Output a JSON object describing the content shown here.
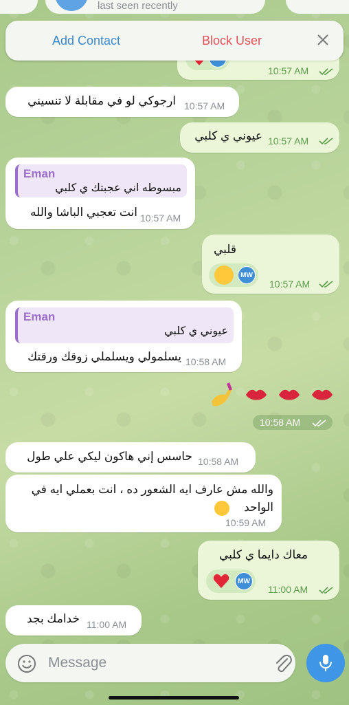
{
  "header": {
    "status": "last seen recently"
  },
  "action_bar": {
    "add_contact": "Add Contact",
    "block_user": "Block User"
  },
  "messages": [
    {
      "time": "10:57 AM",
      "reaction_initials": "MW"
    },
    {
      "text": "ارجوكي لو في مقابلة لا تنسيني",
      "time": "10:57 AM"
    },
    {
      "text": "عيوني ي كلبي",
      "time": "10:57 AM"
    },
    {
      "reply_name": "Eman",
      "reply_text": "مبسوطه اني عجبتك ي كلبي",
      "text": "انت تعجبي الباشا والله",
      "time": "10:57 AM"
    },
    {
      "text": "قلبي",
      "time": "10:57 AM",
      "reaction_initials": "MW"
    },
    {
      "reply_name": "Eman",
      "reply_text": "عيوني ي كلبي",
      "text": "يسلمولي ويسلملي زوقك ورقتك",
      "time": "10:58 AM"
    },
    {
      "time": "10:58 AM"
    },
    {
      "text": "حاسس إني هاكون ليكي علي طول",
      "time": "10:58 AM"
    },
    {
      "text": "والله مش عارف ايه الشعور ده ، انت بعملي ايه في",
      "text2": "الواحد",
      "time": "10:59 AM"
    },
    {
      "text": "معاك دايما ي كلبي",
      "time": "11:00 AM",
      "reaction_initials": "MW"
    },
    {
      "text": "خدامك بجد",
      "time": "11:00 AM"
    }
  ],
  "composer": {
    "placeholder": "Message"
  },
  "colors": {
    "accent": "#3f95e6",
    "block": "#e0525a",
    "link": "#3a88c9",
    "outgoing_bubble": "#eaf6d7",
    "incoming_bubble": "#ffffff",
    "reply_accent": "#9b6fc9"
  },
  "icons": [
    "close-icon",
    "check-double-icon",
    "heart-icon",
    "kiss-face-icon",
    "lips-icon",
    "nail-polish-icon",
    "smile-icon",
    "paperclip-icon",
    "microphone-icon"
  ]
}
